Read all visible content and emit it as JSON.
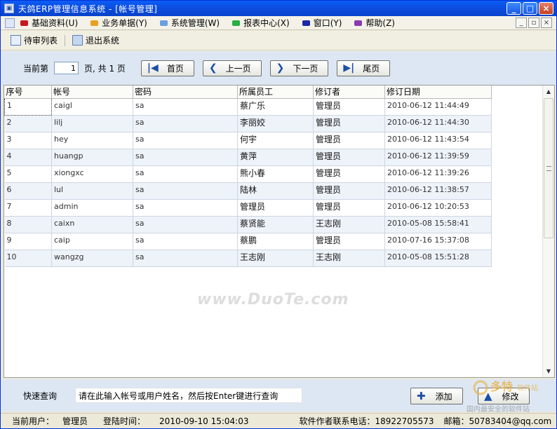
{
  "window": {
    "title": "天鸽ERP管理信息系统 - [帐号管理]",
    "controls": [
      "_",
      "□",
      "×"
    ]
  },
  "menu": {
    "items": [
      {
        "label": "基础资料(U)",
        "color": "#c8181e"
      },
      {
        "label": "业务单据(Y)",
        "color": "#e8a020"
      },
      {
        "label": "系统管理(W)",
        "color": "#6aa0e0"
      },
      {
        "label": "报表中心(X)",
        "color": "#28b040"
      },
      {
        "label": "窗口(Y)",
        "color": "#1a2aa8"
      },
      {
        "label": "帮助(Z)",
        "color": "#8a3ab0"
      }
    ],
    "mdi_controls": [
      "_",
      "▫",
      "×"
    ]
  },
  "toolbar": {
    "pending_label": "待审列表",
    "exit_label": "退出系统"
  },
  "pager": {
    "current_label": "当前第",
    "page_value": "1",
    "total_label": "页, 共 1 页",
    "first_label": "首页",
    "prev_label": "上一页",
    "next_label": "下一页",
    "last_label": "尾页"
  },
  "grid": {
    "columns": [
      "序号",
      "帐号",
      "密码",
      "所属员工",
      "修订者",
      "修订日期"
    ],
    "rows": [
      [
        "1",
        "caigl",
        "sa",
        "蔡广乐",
        "管理员",
        "2010-06-12 11:44:49"
      ],
      [
        "2",
        "lilj",
        "sa",
        "李丽姣",
        "管理员",
        "2010-06-12 11:44:30"
      ],
      [
        "3",
        "hey",
        "sa",
        "何宇",
        "管理员",
        "2010-06-12 11:43:54"
      ],
      [
        "4",
        "huangp",
        "sa",
        "黄萍",
        "管理员",
        "2010-06-12 11:39:59"
      ],
      [
        "5",
        "xiongxc",
        "sa",
        "熊小春",
        "管理员",
        "2010-06-12 11:39:26"
      ],
      [
        "6",
        "lul",
        "sa",
        "陆林",
        "管理员",
        "2010-06-12 11:38:57"
      ],
      [
        "7",
        "admin",
        "sa",
        "管理员",
        "管理员",
        "2010-06-12 10:20:53"
      ],
      [
        "8",
        "caixn",
        "sa",
        "蔡贤能",
        "王志刚",
        "2010-05-08 15:58:41"
      ],
      [
        "9",
        "caip",
        "sa",
        "蔡鹏",
        "管理员",
        "2010-07-16 15:37:08"
      ],
      [
        "10",
        "wangzg",
        "sa",
        "王志刚",
        "王志刚",
        "2010-05-08 15:51:28"
      ]
    ]
  },
  "watermark": "www.DuoTe.com",
  "query": {
    "label": "快速查询",
    "value": "请在此输入帐号或用户姓名，然后按Enter键进行查询",
    "add_label": "添加",
    "edit_label": "修改"
  },
  "status": {
    "user_label": "当前用户：",
    "user_value": "管理员",
    "login_label": "登陆时间：",
    "login_value": "2010-09-10 15:04:03",
    "phone_text": "软件作者联系电话：18922705573",
    "email_text": "邮箱：50783404@qq.com"
  },
  "corner_logo": {
    "brand": "多特",
    "sub": "软件站",
    "tagline": "国内最安全的软件站"
  }
}
